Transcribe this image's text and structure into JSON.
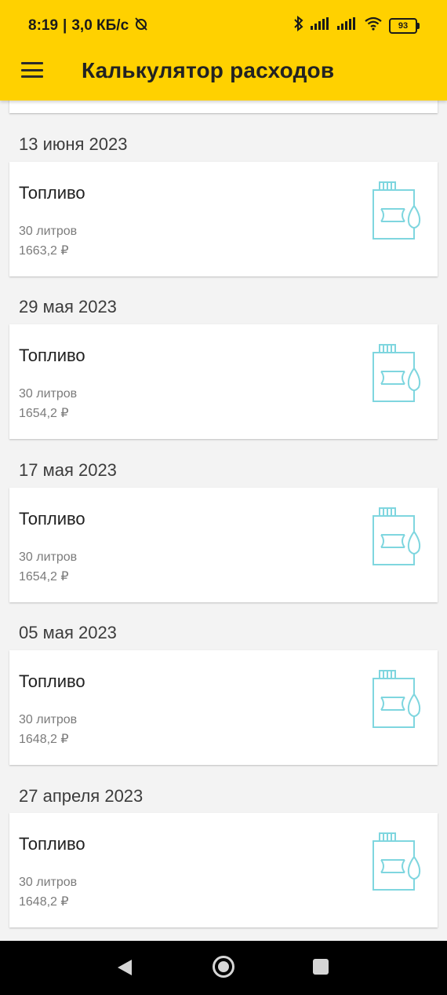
{
  "status_bar": {
    "time": "8:19",
    "speed": "3,0 КБ/с",
    "battery": "93"
  },
  "toolbar": {
    "title": "Калькулятор расходов"
  },
  "entries": [
    {
      "date": "13 июня 2023",
      "title": "Топливо",
      "amount": "30 литров",
      "price": "1663,2 ₽"
    },
    {
      "date": "29 мая 2023",
      "title": "Топливо",
      "amount": "30 литров",
      "price": "1654,2 ₽"
    },
    {
      "date": "17 мая 2023",
      "title": "Топливо",
      "amount": "30 литров",
      "price": "1654,2 ₽"
    },
    {
      "date": "05 мая 2023",
      "title": "Топливо",
      "amount": "30 литров",
      "price": "1648,2 ₽"
    },
    {
      "date": "27 апреля 2023",
      "title": "Топливо",
      "amount": "30 литров",
      "price": "1648,2 ₽"
    }
  ],
  "icons": {
    "entry_icon": "fuel-canister-icon",
    "accent_color": "#7fd6df",
    "toolbar_color": "#ffd100"
  }
}
